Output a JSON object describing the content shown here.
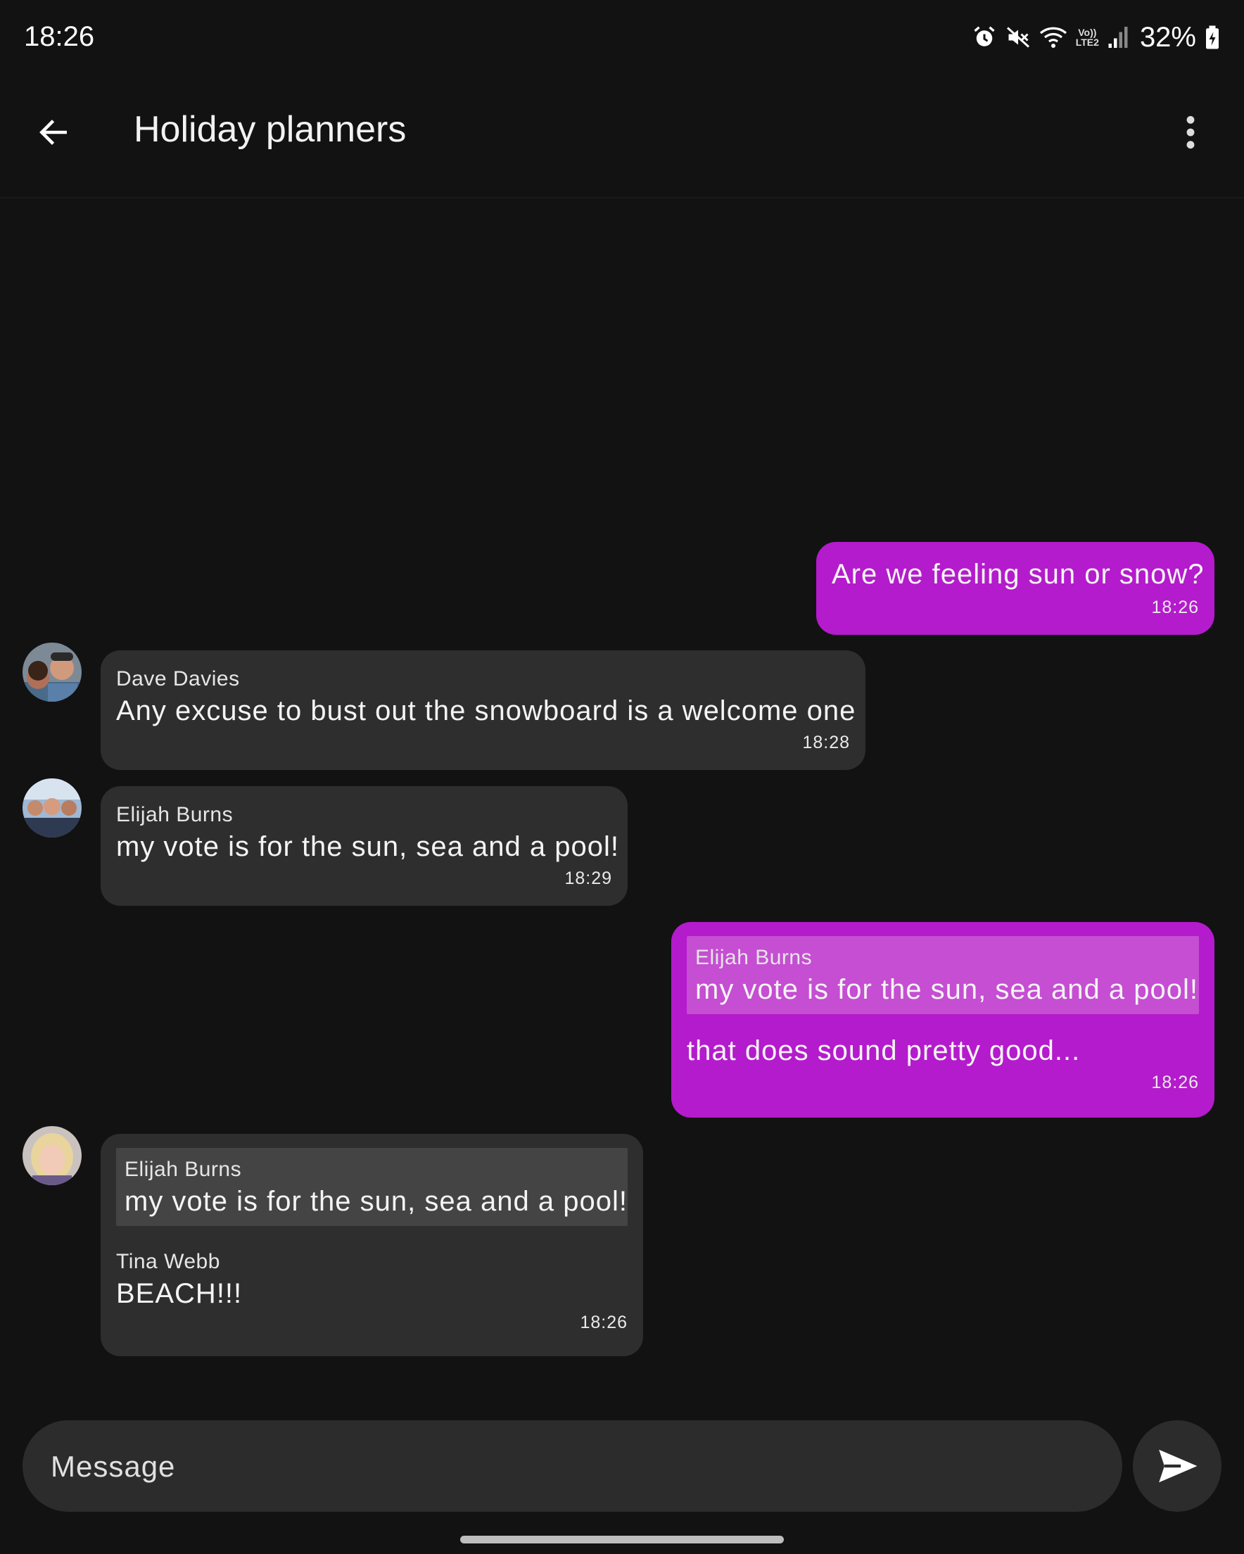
{
  "status_bar": {
    "time": "18:26",
    "volte_line1": "Vo))",
    "volte_line2": "LTE2",
    "battery_percent": "32%"
  },
  "header": {
    "title": "Holiday planners"
  },
  "messages": [
    {
      "direction": "outgoing",
      "text": "Are we feeling sun or snow?",
      "time": "18:26"
    },
    {
      "direction": "incoming",
      "sender": "Dave Davies",
      "text": "Any excuse to bust out the snowboard is a welcome one",
      "time": "18:28"
    },
    {
      "direction": "incoming",
      "sender": "Elijah Burns",
      "text": "my vote is for the sun, sea and a pool!",
      "time": "18:29"
    },
    {
      "direction": "outgoing",
      "quote_sender": "Elijah Burns",
      "quote_text": "my vote is for the sun, sea and a pool!",
      "text": "that does sound pretty good...",
      "time": "18:26"
    },
    {
      "direction": "incoming",
      "quote_sender": "Elijah Burns",
      "quote_text": "my vote is for the sun, sea and a pool!",
      "sender": "Tina Webb",
      "text": "BEACH!!!",
      "time": "18:26"
    }
  ],
  "composer": {
    "placeholder": "Message"
  },
  "colors": {
    "background": "#121212",
    "outgoing_bubble": "#b41bcc",
    "incoming_bubble": "#2e2e2e",
    "composer": "#2c2c2c"
  },
  "icons": {
    "back": "arrow-left-icon",
    "more": "more-vert-icon",
    "send": "send-icon",
    "alarm": "alarm-icon",
    "mute": "volume-mute-icon",
    "wifi": "wifi-icon",
    "signal": "signal-icon",
    "battery": "battery-charging-icon"
  }
}
